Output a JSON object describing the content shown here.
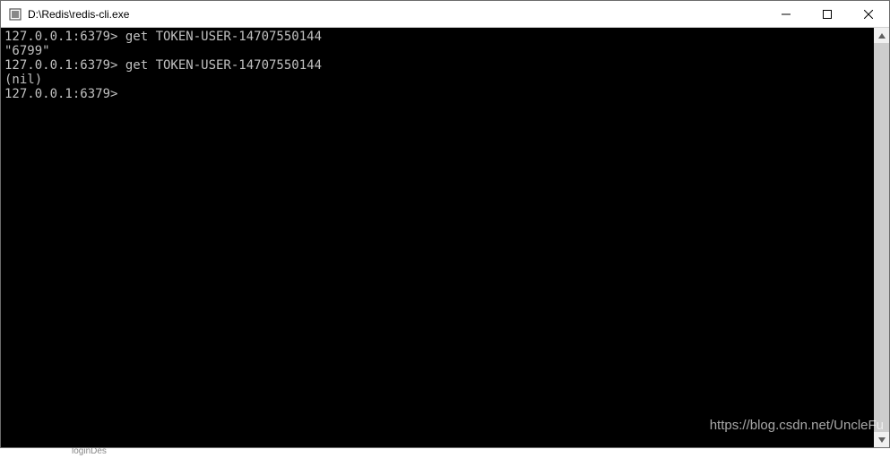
{
  "window": {
    "title": "D:\\Redis\\redis-cli.exe"
  },
  "terminal": {
    "lines": [
      {
        "prompt": "127.0.0.1:6379>",
        "command": "get TOKEN-USER-14707550144"
      },
      {
        "output": "\"6799\""
      },
      {
        "prompt": "127.0.0.1:6379>",
        "command": "get TOKEN-USER-14707550144"
      },
      {
        "output": "(nil)"
      },
      {
        "prompt": "127.0.0.1:6379>",
        "command": ""
      }
    ]
  },
  "watermark": "https://blog.csdn.net/UncleFu",
  "bg_hint": "loginDes"
}
